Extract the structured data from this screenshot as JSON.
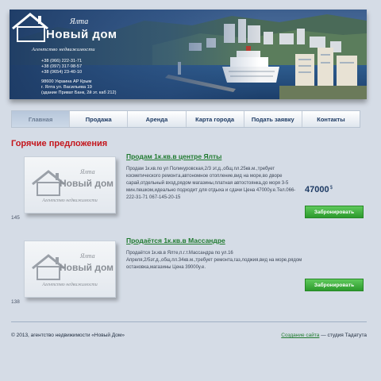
{
  "header": {
    "logo_script": "Ялта",
    "logo_text": "Новый дом",
    "tagline": "Агентство недвижимости",
    "phones": [
      "+38 (066) 222-31-71",
      "+38 (097) 317-98-57",
      "+38 (0654) 23-40-10"
    ],
    "address": [
      "98600 Украина АР Крым",
      "г. Ялта ул. Васильева 19",
      "(здание Приват Банк, 2й эт. каб 212)"
    ]
  },
  "nav": {
    "items": [
      {
        "label": "Главная",
        "active": true
      },
      {
        "label": "Продажа",
        "active": false
      },
      {
        "label": "Аренда",
        "active": false
      },
      {
        "label": "Карта города",
        "active": false
      },
      {
        "label": "Подать заявку",
        "active": false
      },
      {
        "label": "Контакты",
        "active": false
      }
    ]
  },
  "main": {
    "section_title": "Горячие предложения",
    "listings": [
      {
        "id": "145",
        "title": "Продам 1к.кв.в центре Ялты",
        "description": "Продам 1к.кв.по ул Поликуровская,2/3 эт.д.,общ.пл.25кв.м.,требует косметического ремонта,автономное отопление,вид на море,во дворе сарай,отдельный вход,рядом магазины,платная автостоянка,до моря 3-5 мин.пешком,идеально подходит для отдыха и сдачи Цена 47000у.е.Тел.066-222-31-71   067-145-20-15",
        "price": "47000",
        "currency": "$",
        "button_label": "Забронировать"
      },
      {
        "id": "138",
        "title": "Продаётся 1к.кв.в Массандре",
        "description": "Продаётся 1к.кв.в Ялте,п.г.т.Массандра по ул.16 Апреля,2/5эт.д.,общ.пл.34кв.м.,требует ремонта,газ,лоджия,вид на море,рядом остановка,магазины Цена 39000у.е.",
        "price": "",
        "currency": "",
        "button_label": "Забронировать"
      }
    ],
    "thumb_logo_script": "Ялта",
    "thumb_logo_text": "Новый дом",
    "thumb_tagline": "Агентство недвижимости"
  },
  "footer": {
    "copyright": "© 2013, агентство недвижимости «Новый Дом»",
    "credit_link": "Создание сайта",
    "credit_text": " — студия Тадатута"
  },
  "colors": {
    "page_bg": "#d5dce6",
    "accent_red": "#c4161c",
    "link_green": "#1f7a2f",
    "button_green": "#3aab3a",
    "nav_text": "#1d3a63"
  }
}
